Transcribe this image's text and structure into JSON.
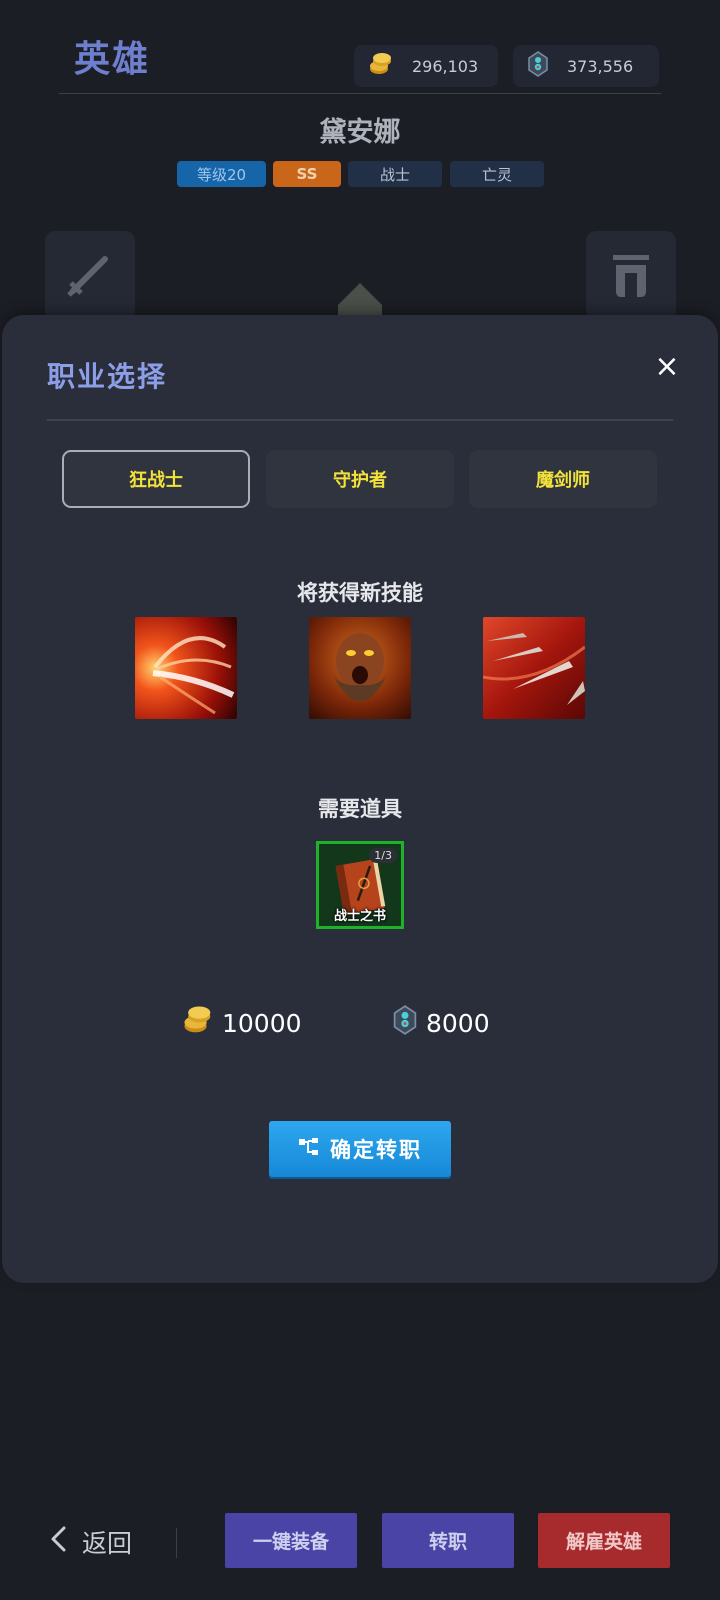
{
  "header": {
    "title": "英雄",
    "resources": {
      "gold": "296,103",
      "crystal": "373,556"
    }
  },
  "hero": {
    "name": "黛安娜",
    "tags": {
      "level": "等级20",
      "grade": "SS",
      "class": "战士",
      "race": "亡灵"
    }
  },
  "modal": {
    "title": "职业选择",
    "close_icon": "×",
    "class_tabs": [
      {
        "label": "狂战士",
        "selected": true
      },
      {
        "label": "守护者",
        "selected": false
      },
      {
        "label": "魔剑师",
        "selected": false
      }
    ],
    "skills_heading": "将获得新技能",
    "items_heading": "需要道具",
    "required_item": {
      "name": "战士之书",
      "count": "1/3"
    },
    "cost": {
      "gold": "10000",
      "crystal": "8000"
    },
    "confirm_label": "确定转职"
  },
  "bottom": {
    "back_label": "返回",
    "equip_all_label": "一键装备",
    "transfer_label": "转职",
    "dismiss_label": "解雇英雄"
  },
  "colors": {
    "accent_title": "#8c9ee8",
    "tab_text": "#f3e23a",
    "confirm_button": "#1f96e3",
    "dismiss_button": "#a72a2c"
  }
}
